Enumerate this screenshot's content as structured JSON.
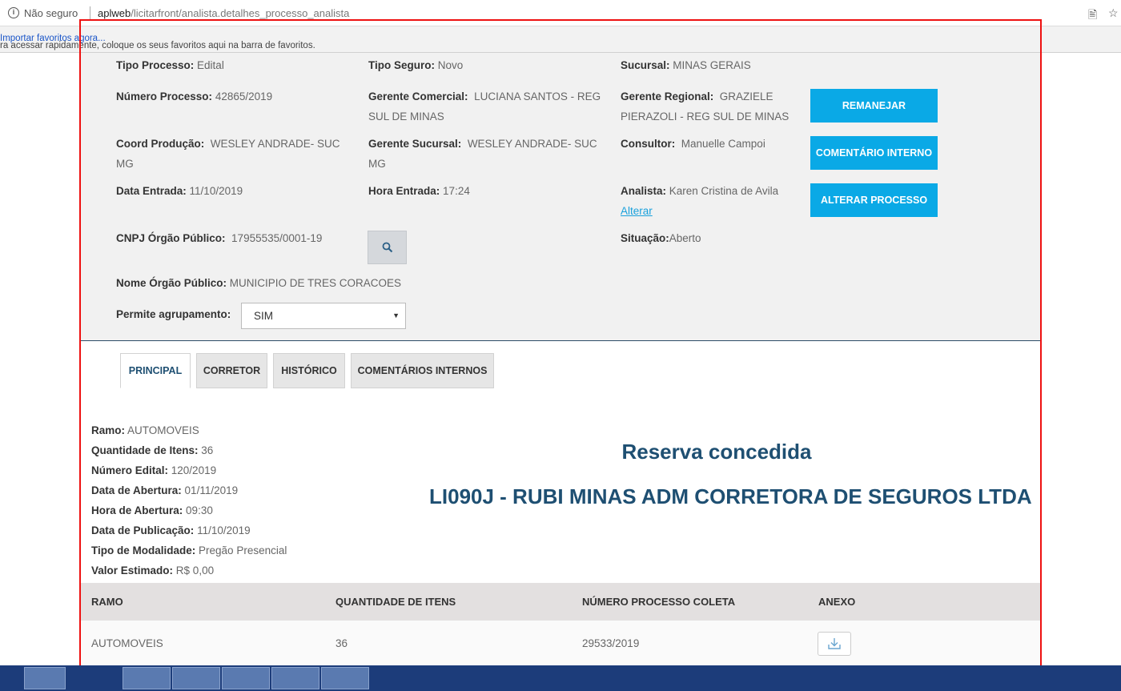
{
  "browser": {
    "security_label": "Não seguro",
    "url_host": "aplweb",
    "url_path": "/licitarfront/analista.detalhes_processo_analista",
    "bookmarks_text": "ra acessar rapidamente, coloque os seus favoritos aqui na barra de favoritos.",
    "bookmarks_link": "Importar favoritos agora..."
  },
  "process": {
    "tipo_processo": {
      "label": "Tipo Processo:",
      "value": "Edital"
    },
    "tipo_seguro": {
      "label": "Tipo Seguro:",
      "value": "Novo"
    },
    "sucursal": {
      "label": "Sucursal:",
      "value": "MINAS GERAIS"
    },
    "numero_processo": {
      "label": "Número Processo:",
      "value": "42865/2019"
    },
    "gerente_comercial": {
      "label": "Gerente Comercial:",
      "value1": "LUCIANA SANTOS - REG",
      "value2": "SUL DE MINAS"
    },
    "gerente_regional": {
      "label": "Gerente Regional:",
      "value1": "GRAZIELE",
      "value2": "PIERAZOLI - REG SUL DE MINAS"
    },
    "coord_producao": {
      "label": "Coord Produção:",
      "value1": "WESLEY ANDRADE- SUC",
      "value2": "MG"
    },
    "gerente_sucursal": {
      "label": "Gerente Sucursal:",
      "value1": "WESLEY ANDRADE- SUC",
      "value2": "MG"
    },
    "consultor": {
      "label": "Consultor:",
      "value": "Manuelle Campoi"
    },
    "data_entrada": {
      "label": "Data Entrada:",
      "value": "11/10/2019"
    },
    "hora_entrada": {
      "label": "Hora Entrada:",
      "value": "17:24"
    },
    "analista": {
      "label": "Analista:",
      "value": "Karen Cristina de Avila",
      "link": "Alterar"
    },
    "cnpj": {
      "label": "CNPJ Órgão Público:",
      "value": "17955535/0001-19"
    },
    "situacao": {
      "label": "Situação:",
      "value": "Aberto"
    },
    "nome_orgao": {
      "label": "Nome Órgão Público:",
      "value": "MUNICIPIO DE TRES CORACOES"
    },
    "permite_agrupamento": {
      "label": "Permite agrupamento:",
      "value": "SIM"
    }
  },
  "buttons": {
    "remanejar": "REMANEJAR",
    "comentario": "COMENTÁRIO INTERNO",
    "alterar": "ALTERAR PROCESSO"
  },
  "tabs": [
    "PRINCIPAL",
    "CORRETOR",
    "HISTÓRICO",
    "COMENTÁRIOS INTERNOS"
  ],
  "details": [
    {
      "label": "Ramo:",
      "value": "AUTOMOVEIS"
    },
    {
      "label": "Quantidade de Itens:",
      "value": "36"
    },
    {
      "label": "Número Edital:",
      "value": "120/2019"
    },
    {
      "label": "Data de Abertura:",
      "value": "01/11/2019"
    },
    {
      "label": "Hora de Abertura:",
      "value": "09:30"
    },
    {
      "label": "Data de Publicação:",
      "value": "11/10/2019"
    },
    {
      "label": "Tipo de Modalidade:",
      "value": "Pregão Presencial"
    },
    {
      "label": "Valor Estimado:",
      "value": "R$ 0,00"
    }
  ],
  "reserva": {
    "title": "Reserva concedida",
    "corretora": "LI090J - RUBI MINAS ADM CORRETORA DE SEGUROS LTDA"
  },
  "table": {
    "headers": [
      "RAMO",
      "QUANTIDADE DE ITENS",
      "NÚMERO PROCESSO COLETA",
      "ANEXO"
    ],
    "rows": [
      {
        "ramo": "AUTOMOVEIS",
        "quantidade": "36",
        "numero": "29533/2019"
      }
    ]
  }
}
